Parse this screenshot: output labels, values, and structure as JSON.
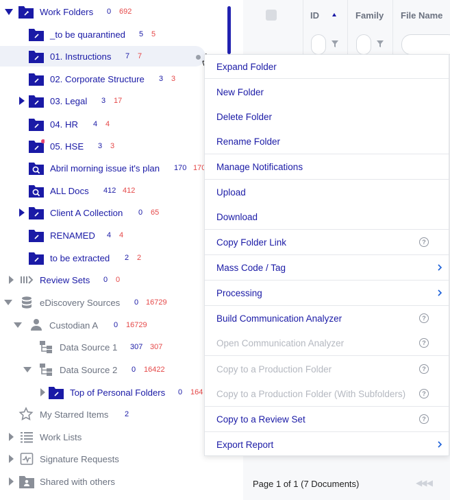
{
  "tree": [
    {
      "label": "Work Folders",
      "count1": "0",
      "count2": "692",
      "icon": "work-folder-icon",
      "expand": "expanded"
    },
    {
      "label": "_to be quarantined",
      "count1": "5",
      "count2": "5",
      "icon": "folder-icon"
    },
    {
      "label": "01. Instructions",
      "count1": "7",
      "count2": "7",
      "icon": "folder-icon"
    },
    {
      "label": "02. Corporate Structure",
      "count1": "3",
      "count2": "3",
      "icon": "folder-icon"
    },
    {
      "label": "03. Legal",
      "count1": "3",
      "count2": "17",
      "icon": "folder-icon",
      "expand": "collapsed"
    },
    {
      "label": "04. HR",
      "count1": "4",
      "count2": "4",
      "icon": "folder-icon"
    },
    {
      "label": "05. HSE",
      "count1": "3",
      "count2": "3",
      "icon": "folder-icon"
    },
    {
      "label": "Abril morning issue it's plan",
      "count1": "170",
      "count2": "170",
      "icon": "search-folder-icon"
    },
    {
      "label": "ALL Docs",
      "count1": "412",
      "count2": "412",
      "icon": "search-folder-icon"
    },
    {
      "label": "Client A Collection",
      "count1": "0",
      "count2": "65",
      "icon": "folder-icon",
      "expand": "collapsed"
    },
    {
      "label": "RENAMED",
      "count1": "4",
      "count2": "4",
      "icon": "folder-icon"
    },
    {
      "label": "to be extracted",
      "count1": "2",
      "count2": "2",
      "icon": "folder-icon"
    },
    {
      "label": "Review Sets",
      "count1": "0",
      "count2": "0",
      "icon": "review-sets-icon",
      "expand": "collapsed"
    },
    {
      "label": "eDiscovery Sources",
      "count1": "0",
      "count2": "16729",
      "icon": "database-icon",
      "expand": "expanded"
    },
    {
      "label": "Custodian A",
      "count1": "0",
      "count2": "16729",
      "icon": "person-icon",
      "expand": "expanded"
    },
    {
      "label": "Data Source 1",
      "count1": "307",
      "count2": "307",
      "icon": "data-source-icon"
    },
    {
      "label": "Data Source 2",
      "count1": "0",
      "count2": "16422",
      "icon": "data-source-icon",
      "expand": "expanded"
    },
    {
      "label": "Top of Personal Folders",
      "count1": "0",
      "count2": "164",
      "icon": "folder-icon",
      "expand": "collapsed"
    },
    {
      "label": "My Starred Items",
      "count1": "2",
      "count2": "",
      "icon": "star-icon"
    },
    {
      "label": "Work Lists",
      "count1": "",
      "count2": "",
      "icon": "list-icon",
      "expand": "collapsed"
    },
    {
      "label": "Signature Requests",
      "count1": "",
      "count2": "",
      "icon": "signature-icon",
      "expand": "collapsed"
    },
    {
      "label": "Shared with others",
      "count1": "",
      "count2": "",
      "icon": "shared-folder-icon",
      "expand": "collapsed"
    }
  ],
  "grid": {
    "columns": [
      "ID",
      "Family",
      "File Name"
    ],
    "pager_text": "Page 1 of 1 (7 Documents)"
  },
  "context_menu": {
    "items": [
      {
        "label": "Expand Folder",
        "enabled": true
      },
      {
        "label": "New Folder",
        "enabled": true
      },
      {
        "label": "Delete Folder",
        "enabled": true
      },
      {
        "label": "Rename Folder",
        "enabled": true
      },
      {
        "label": "Manage Notifications",
        "enabled": true
      },
      {
        "label": "Upload",
        "enabled": true
      },
      {
        "label": "Download",
        "enabled": true
      },
      {
        "label": "Copy Folder Link",
        "enabled": true,
        "help": true
      },
      {
        "label": "Mass Code / Tag",
        "enabled": true,
        "submenu": true
      },
      {
        "label": "Processing",
        "enabled": true,
        "submenu": true
      },
      {
        "label": "Build Communication Analyzer",
        "enabled": true,
        "help": true
      },
      {
        "label": "Open Communication Analyzer",
        "enabled": false,
        "help": true
      },
      {
        "label": "Copy to a Production Folder",
        "enabled": false,
        "help": true
      },
      {
        "label": "Copy to a Production Folder (With Subfolders)",
        "enabled": false,
        "help": true
      },
      {
        "label": "Copy to a Review Set",
        "enabled": true,
        "help": true
      },
      {
        "label": "Export Report",
        "enabled": true,
        "submenu": true
      }
    ],
    "help_glyph": "?"
  },
  "colors": {
    "accent": "#1a1aa6",
    "count_red": "#e54848",
    "muted": "#6b7280",
    "disabled": "#b4b8c0"
  }
}
